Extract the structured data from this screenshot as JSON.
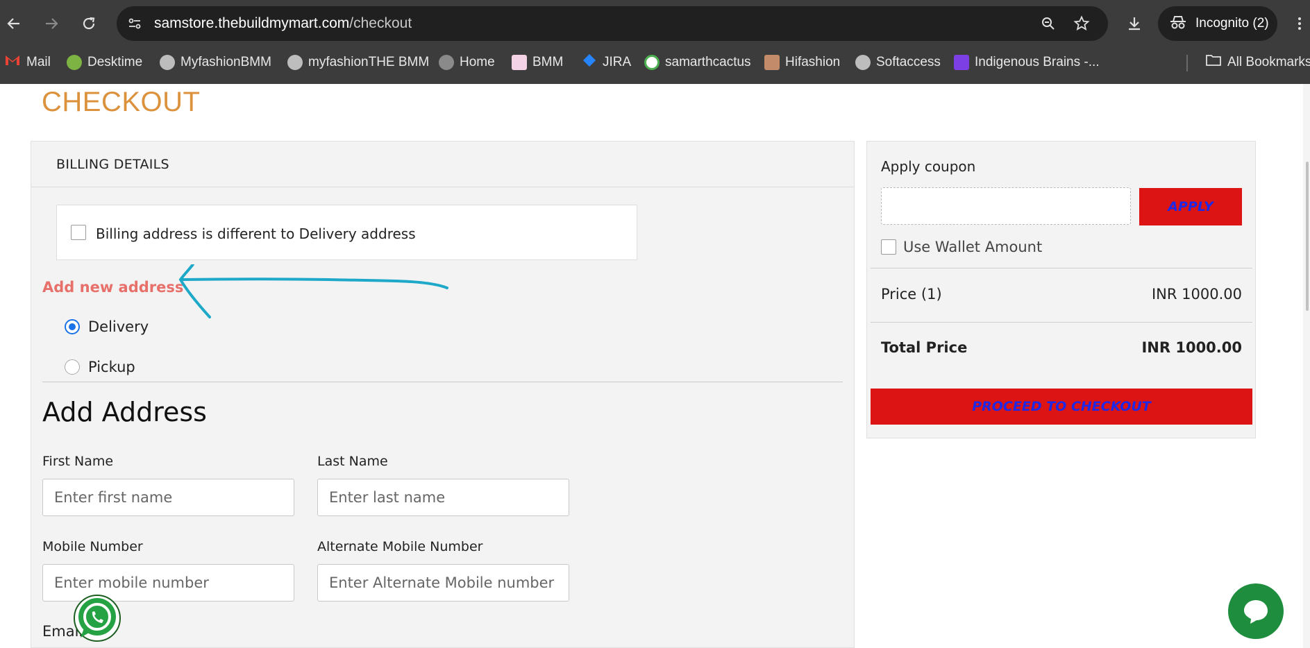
{
  "browser": {
    "url_host": "samstore.thebuildmymart.com",
    "url_path": "/checkout",
    "incognito_label": "Incognito (2)",
    "bookmarks": [
      {
        "label": "Mail",
        "icon": "gmail-icon",
        "color": "#ea4335"
      },
      {
        "label": "Desktime",
        "icon": "desktime-icon",
        "color": "#7cb342"
      },
      {
        "label": "MyfashionBMM",
        "icon": "globe-icon",
        "color": "#bdbdbd"
      },
      {
        "label": "myfashionTHE BMM",
        "icon": "globe-icon",
        "color": "#bdbdbd"
      },
      {
        "label": "Home",
        "icon": "globe-icon",
        "color": "#8a8a8a"
      },
      {
        "label": "BMM",
        "icon": "bmm-icon",
        "color": "#d05ca0"
      },
      {
        "label": "JIRA",
        "icon": "jira-icon",
        "color": "#2684ff"
      },
      {
        "label": "samarthcactus",
        "icon": "cactus-icon",
        "color": "#4caf50"
      },
      {
        "label": "Hifashion",
        "icon": "hifashion-icon",
        "color": "#c48b6a"
      },
      {
        "label": "Softaccess",
        "icon": "globe-icon",
        "color": "#bdbdbd"
      },
      {
        "label": "Indigenous Brains -...",
        "icon": "indigenous-icon",
        "color": "#7b3fe4"
      }
    ],
    "all_bookmarks_label": "All Bookmarks"
  },
  "page": {
    "title": "CHECKOUT",
    "billing": {
      "header": "BILLING DETAILS",
      "different_address_label": "Billing address is different to Delivery address",
      "add_new_address": "Add new address",
      "options": [
        {
          "label": "Delivery",
          "selected": true
        },
        {
          "label": "Pickup",
          "selected": false
        }
      ],
      "add_address_heading": "Add Address",
      "fields": {
        "first_name": {
          "label": "First Name",
          "placeholder": "Enter first name"
        },
        "last_name": {
          "label": "Last Name",
          "placeholder": "Enter last name"
        },
        "mobile": {
          "label": "Mobile Number",
          "placeholder": "Enter mobile number"
        },
        "alt_mobile": {
          "label": "Alternate Mobile Number",
          "placeholder": "Enter Alternate Mobile number"
        },
        "email": {
          "label": "Email"
        }
      }
    },
    "summary": {
      "coupon_label": "Apply coupon",
      "apply_button": "APPLY",
      "wallet_label": "Use Wallet Amount",
      "price_label": "Price (1)",
      "price_value": "INR 1000.00",
      "total_label": "Total Price",
      "total_value": "INR 1000.00",
      "proceed_button": "PROCEED TO CHECKOUT"
    }
  },
  "colors": {
    "accent_orange": "#dc923d",
    "button_red": "#dc1414",
    "button_text_blue": "#1e28e8",
    "add_new_link": "#e8706b",
    "annotation_arrow": "#1ea9c9",
    "chat_green": "#1e8e3e"
  }
}
